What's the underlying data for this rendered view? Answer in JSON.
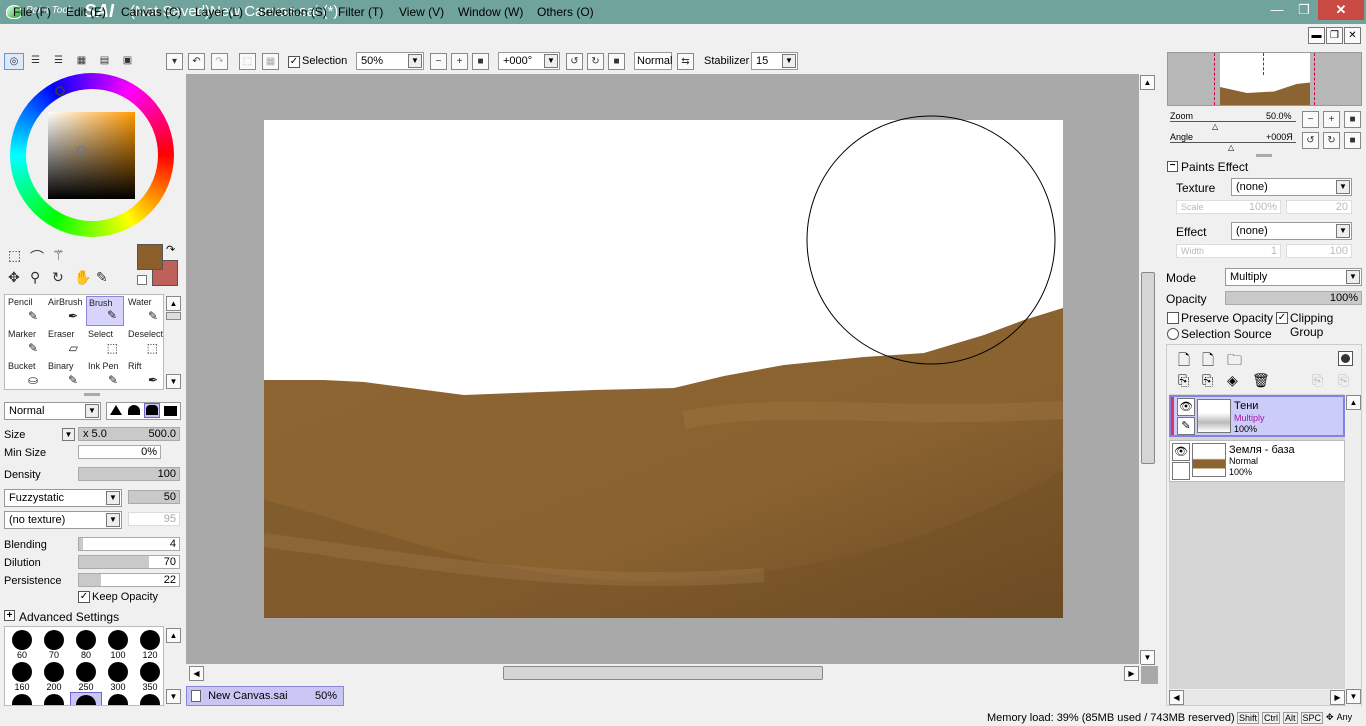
{
  "app": {
    "logo_text_small": "Paint Tool",
    "logo_text_big": "SAI",
    "window_title": "(Not Saved)New Canvas.sai (*)"
  },
  "menu": [
    "File (F)",
    "Edit (E)",
    "Canvas (C)",
    "Layer (L)",
    "Selection (S)",
    "Filter (T)",
    "View (V)",
    "Window (W)",
    "Others (O)"
  ],
  "toolbar": {
    "selection_label": "Selection",
    "selection_checked": true,
    "zoom": "50%",
    "angle": "+000°",
    "blend_mode": "Normal",
    "stabilizer_label": "Stabilizer",
    "stabilizer_value": "15"
  },
  "tools": [
    {
      "label": "Pencil",
      "icon": "pencil-icon",
      "glyph": "✎"
    },
    {
      "label": "AirBrush",
      "icon": "airbrush-icon",
      "glyph": "✒"
    },
    {
      "label": "Brush",
      "icon": "brush-icon",
      "glyph": "✎",
      "selected": true
    },
    {
      "label": "Water",
      "icon": "water-icon",
      "glyph": "✎"
    },
    {
      "label": "Marker",
      "icon": "marker-icon",
      "glyph": "✎"
    },
    {
      "label": "Eraser",
      "icon": "eraser-icon",
      "glyph": "▱"
    },
    {
      "label": "Select",
      "icon": "select-icon",
      "glyph": "⬚"
    },
    {
      "label": "Deselect",
      "icon": "deselect-icon",
      "glyph": "⬚"
    },
    {
      "label": "Bucket",
      "icon": "bucket-icon",
      "glyph": "⛀"
    },
    {
      "label": "Binary",
      "icon": "binary-icon",
      "glyph": "✎"
    },
    {
      "label": "Ink Pen",
      "icon": "ink-pen-icon",
      "glyph": "✎"
    },
    {
      "label": "Rift",
      "icon": "rift-icon",
      "glyph": "✒"
    }
  ],
  "colors": {
    "primary": "#8a5f2a",
    "secondary": "#c0605a",
    "ground": "#8b6431"
  },
  "brush": {
    "blend": "Normal",
    "size_label": "Size",
    "size_mult": "x 5.0",
    "size_value": "500.0",
    "min_size_label": "Min Size",
    "min_size_value": "0%",
    "density_label": "Density",
    "density_value": "100",
    "shape": "Fuzzystatic",
    "shape_value": "50",
    "texture": "(no texture)",
    "texture_value": "95",
    "blending_label": "Blending",
    "blending_value": "4",
    "dilution_label": "Dilution",
    "dilution_value": "70",
    "persistence_label": "Persistence",
    "persistence_value": "22",
    "keep_opacity_label": "Keep Opacity",
    "keep_opacity_checked": true,
    "advanced_label": "Advanced Settings",
    "sizes": [
      "60",
      "70",
      "80",
      "100",
      "120",
      "160",
      "200",
      "250",
      "300",
      "350"
    ]
  },
  "document_tab": {
    "name": "New Canvas.sai",
    "zoom": "50%"
  },
  "status": {
    "memory": "Memory load: 39% (85MB used / 743MB reserved)",
    "keys": [
      "Shift",
      "Ctrl",
      "Alt",
      "SPC",
      "Any"
    ]
  },
  "navigator": {
    "zoom_label": "Zoom",
    "zoom_value": "50.0%",
    "angle_label": "Angle",
    "angle_value": "+000Я"
  },
  "paints_effect": {
    "header": "Paints Effect",
    "texture_label": "Texture",
    "texture_value": "(none)",
    "scale_label": "Scale",
    "scale_value": "100%",
    "scale_value2": "20",
    "effect_label": "Effect",
    "effect_value": "(none)",
    "width_label": "Width",
    "width_value": "1",
    "width_value2": "100"
  },
  "layer_props": {
    "mode_label": "Mode",
    "mode_value": "Multiply",
    "opacity_label": "Opacity",
    "opacity_value": "100%",
    "preserve_opacity": "Preserve Opacity",
    "clipping_group": "Clipping Group",
    "clipping_checked": true,
    "selection_source": "Selection Source"
  },
  "layers": [
    {
      "name": "Тени",
      "mode": "Multiply",
      "opacity": "100%",
      "selected": true
    },
    {
      "name": "Земля - база",
      "mode": "Normal",
      "opacity": "100%",
      "selected": false
    }
  ]
}
